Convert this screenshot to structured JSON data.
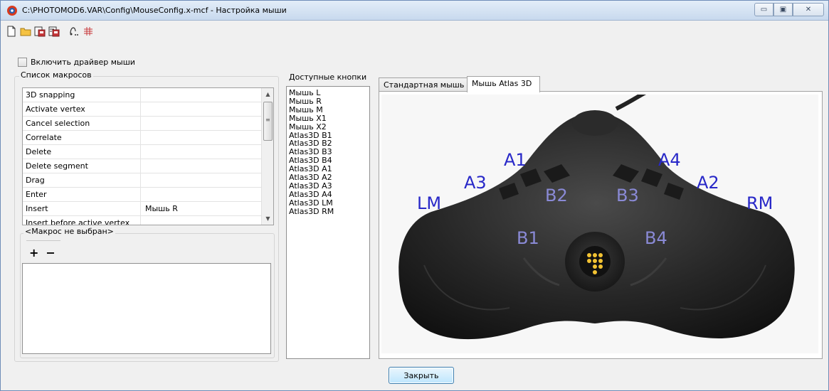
{
  "window": {
    "title": "C:\\PHOTOMOD6.VAR\\Config\\MouseConfig.x-mcf - Настройка мыши",
    "minimize_glyph": "▭",
    "maximize_glyph": "▣",
    "close_glyph": "✕"
  },
  "toolbar": {
    "icons": [
      "new-file-icon",
      "open-folder-icon",
      "save-icon",
      "save-as-icon",
      "test-icon",
      "grid-icon"
    ]
  },
  "driver": {
    "label": "Включить драйвер мыши",
    "checked": false
  },
  "macros": {
    "group_label": "Список макросов",
    "rows": [
      {
        "name": "3D snapping",
        "key": ""
      },
      {
        "name": "Activate vertex",
        "key": ""
      },
      {
        "name": "Cancel selection",
        "key": ""
      },
      {
        "name": "Correlate",
        "key": ""
      },
      {
        "name": "Delete",
        "key": ""
      },
      {
        "name": "Delete segment",
        "key": ""
      },
      {
        "name": "Drag",
        "key": ""
      },
      {
        "name": "Enter",
        "key": ""
      },
      {
        "name": "Insert",
        "key": "Мышь R"
      },
      {
        "name": "Insert before active vertex",
        "key": ""
      }
    ],
    "scroll_up": "▲",
    "scroll_down": "▼",
    "scroll_grip": "≡",
    "selected_macro_label": "<Макрос не выбран>",
    "add_label": "+",
    "remove_label": "−"
  },
  "buttons": {
    "group_label": "Доступные кнопки",
    "items": [
      "Мышь L",
      "Мышь R",
      "Мышь M",
      "Мышь X1",
      "Мышь X2",
      "Atlas3D B1",
      "Atlas3D B2",
      "Atlas3D B3",
      "Atlas3D B4",
      "Atlas3D A1",
      "Atlas3D A2",
      "Atlas3D A3",
      "Atlas3D A4",
      "Atlas3D LM",
      "Atlas3D RM"
    ]
  },
  "tabs": [
    {
      "label": "Стандартная мышь",
      "active": false
    },
    {
      "label": "Мышь Atlas 3D",
      "active": true
    }
  ],
  "mouse_labels": {
    "A1": "A1",
    "A3": "A3",
    "LM": "LM",
    "A4": "A4",
    "A2": "A2",
    "RM": "RM",
    "B2": "B2",
    "B3": "B3",
    "B1": "B1",
    "B4": "B4"
  },
  "footer": {
    "close_label": "Закрыть"
  }
}
